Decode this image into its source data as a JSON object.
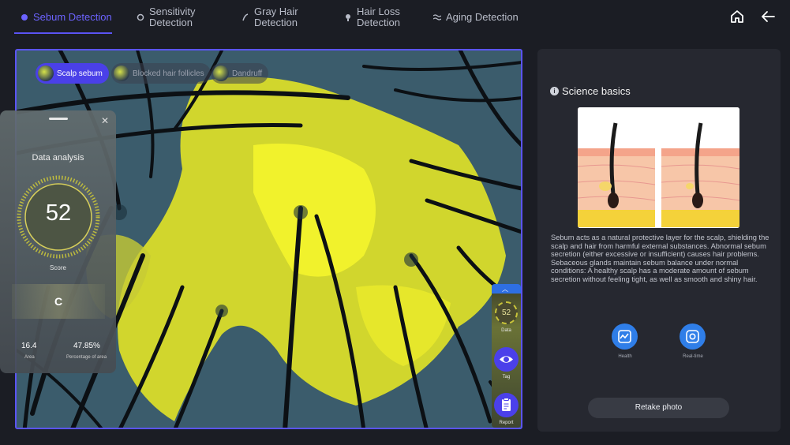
{
  "nav": {
    "tabs": [
      {
        "label": "Sebum Detection",
        "active": true,
        "icon": "sebum-icon"
      },
      {
        "label": "Sensitivity Detection",
        "line1": "Sensitivity",
        "line2": "Detection",
        "active": false,
        "icon": "sensitivity-icon"
      },
      {
        "label": "Gray Hair Detection",
        "line1": "Gray Hair",
        "line2": "Detection",
        "active": false,
        "icon": "gray-hair-icon"
      },
      {
        "label": "Hair Loss Detection",
        "line1": "Hair Loss",
        "line2": "Detection",
        "active": false,
        "icon": "hair-loss-icon"
      },
      {
        "label": "Aging Detection",
        "active": false,
        "icon": "aging-icon"
      }
    ],
    "home_icon": "home-icon",
    "back_icon": "back-arrow-icon",
    "accent": "#5b54f5"
  },
  "chips": [
    {
      "label": "Scalp sebum",
      "active": true
    },
    {
      "label": "Blocked hair follicles",
      "active": false
    },
    {
      "label": "Dandruff",
      "active": false
    }
  ],
  "analysis": {
    "title": "Data analysis",
    "score": "52",
    "score_label": "Score",
    "grade": "C",
    "area_value": "16.4",
    "area_label": "Area",
    "percent_value": "47.85%",
    "percent_label": "Percentage of area"
  },
  "mini_toolbar": {
    "score": "52",
    "data_label": "Data",
    "tag_label": "Tag",
    "report_label": "Report"
  },
  "science": {
    "title": "Science basics",
    "description": "Sebum acts as a natural protective layer for the scalp, shielding the scalp and hair from harmful external substances. Abnormal sebum secretion (either excessive or insufficient) causes hair problems. Sebaceous glands maintain sebum balance under normal conditions: A healthy scalp has a moderate amount of sebum secretion without feeling tight, as well as smooth and shiny hair.",
    "health_label": "Health",
    "realtime_label": "Real-time",
    "retake_label": "Retake photo"
  }
}
